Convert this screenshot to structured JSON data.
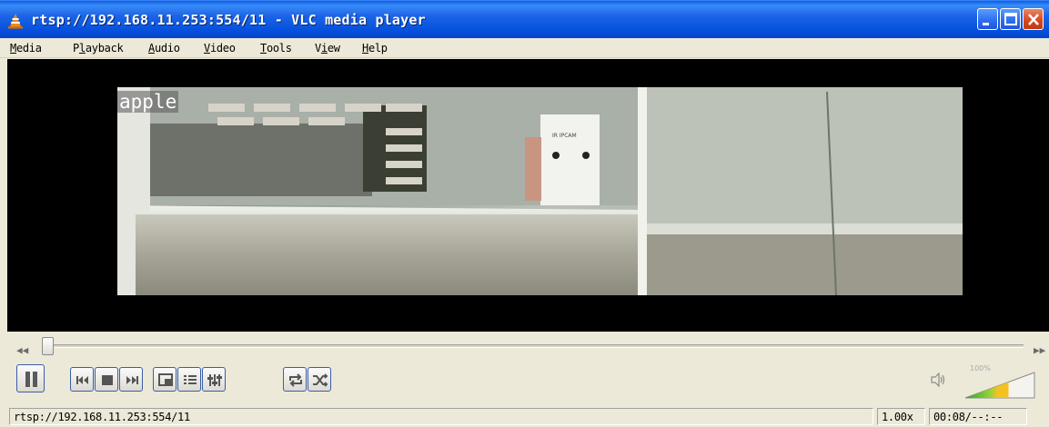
{
  "window": {
    "title": "rtsp://192.168.11.253:554/11 - VLC media player",
    "app_icon": "vlc-cone-icon",
    "buttons": [
      "minimize-icon",
      "maximize-icon",
      "close-icon"
    ]
  },
  "menu": {
    "items": [
      {
        "mnemonic": "M",
        "rest": "edia"
      },
      {
        "mnemonic": "",
        "pre": "P",
        "mn2": "l",
        "rest": "ayback"
      },
      {
        "mnemonic": "A",
        "rest": "udio"
      },
      {
        "mnemonic": "V",
        "rest": "ideo"
      },
      {
        "mnemonic": "T",
        "rest": "ools"
      },
      {
        "pre": "V",
        "mn2": "i",
        "rest": "ew"
      },
      {
        "mnemonic": "H",
        "rest": "elp"
      }
    ]
  },
  "video": {
    "osd_text": "apple",
    "scene_label": "IR IPCAM"
  },
  "seek": {
    "position": 0.0
  },
  "controls": {
    "icons": [
      "pause-icon",
      "previous-icon",
      "stop-icon",
      "next-icon",
      "fullscreen-icon",
      "playlist-icon",
      "extended-settings-icon",
      "loop-icon",
      "shuffle-icon"
    ]
  },
  "volume": {
    "label": "100%",
    "level": 1.0,
    "icon": "speaker-icon"
  },
  "status": {
    "url": "rtsp://192.168.11.253:554/11",
    "speed": "1.00x",
    "time": "00:08/--:--"
  },
  "colors": {
    "titlebar": "#0a5ee6",
    "close": "#d4471d",
    "button_border": "#3a5ea8"
  }
}
